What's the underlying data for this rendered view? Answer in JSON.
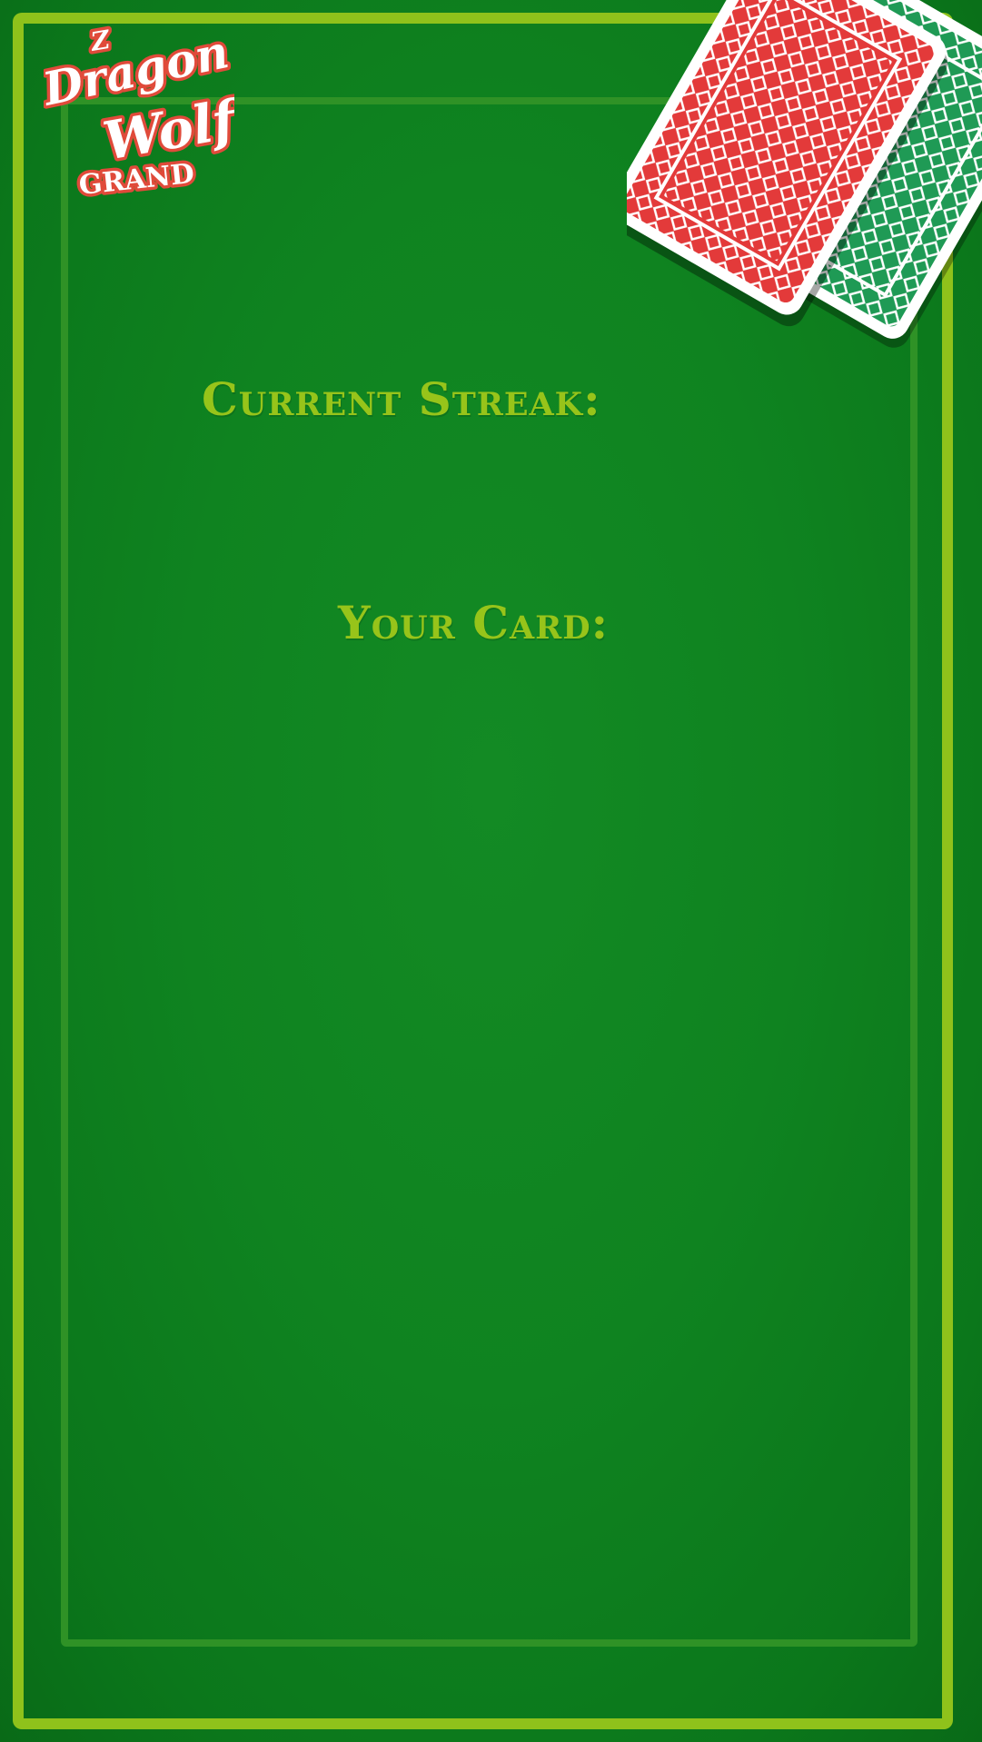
{
  "logo": {
    "name": "dragon-wolf-grand-logo",
    "lines": [
      "Z",
      "Dragon",
      "Wolf",
      "GRAND"
    ]
  },
  "labels": {
    "current_streak": "Current Streak:",
    "your_card": "Your Card:"
  },
  "colors": {
    "felt": "#0f8320",
    "frame": "#8fc21b",
    "inner_frame": "#2f9226",
    "label_text": "#97c41a",
    "card_back_red": "#e33a3a",
    "card_back_green": "#1f9a55"
  },
  "icons": {
    "deck": "card-deck-icon"
  }
}
